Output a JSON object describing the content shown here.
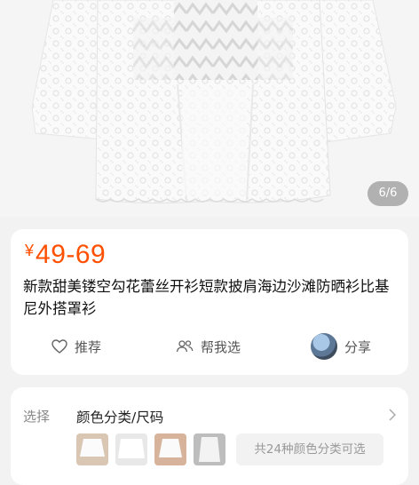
{
  "gallery": {
    "counter": "6/6"
  },
  "product": {
    "currency": "¥",
    "price": "49-69",
    "title": "新款甜美镂空勾花蕾丝开衫短款披肩海边沙滩防晒衫比基尼外搭罩衫"
  },
  "actions": {
    "recommend": "推荐",
    "help_choose": "帮我选",
    "share": "分享"
  },
  "selection": {
    "label": "选择",
    "value": "颜色分类/尺码",
    "more": "共24种颜色分类可选"
  },
  "colors": {
    "price": "#ff5000"
  }
}
